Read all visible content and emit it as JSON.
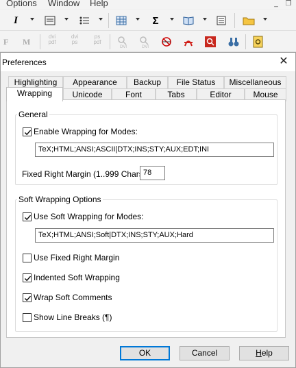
{
  "app": {
    "menu": [
      "Options",
      "Window",
      "Help"
    ],
    "mdi_minimize": "_",
    "mdi_restore": "❐",
    "toolbar2_text": {
      "f": "F",
      "m": "M",
      "dvi_pdf_top": "dvi",
      "dvi_pdf_bottom": "pdf",
      "dvi_ps_top": "dvi",
      "dvi_ps_bottom": "ps",
      "ps_pdf_top": "ps",
      "ps_pdf_bottom": "pdf",
      "dvi_a": "DVI",
      "dvi_b": "DVI"
    },
    "toolbar1_text": {
      "italic": "I",
      "sigma": "Σ"
    }
  },
  "dialog": {
    "title": "Preferences",
    "close_glyph": "✕",
    "tabs_back": [
      "Highlighting",
      "Appearance",
      "Backup",
      "File Status",
      "Miscellaneous"
    ],
    "tabs_front": [
      "Wrapping",
      "Unicode",
      "Font",
      "Tabs",
      "Editor",
      "Mouse"
    ],
    "general": {
      "legend": "General",
      "enable_wrapping_label": "Enable Wrapping for Modes:",
      "enable_wrapping_checked": true,
      "wrapping_modes": "TeX;HTML;ANSI;ASCII|DTX;INS;STY;AUX;EDT;INI",
      "fixed_margin_label": "Fixed Right Margin (1..999 Chars):",
      "fixed_margin_value": "78"
    },
    "soft": {
      "legend": "Soft Wrapping Options",
      "use_soft_label": "Use Soft Wrapping for Modes:",
      "use_soft_checked": true,
      "soft_modes": "TeX;HTML;ANSI;Soft|DTX;INS;STY;AUX;Hard",
      "fixed_margin_label": "Use Fixed Right Margin",
      "fixed_margin_checked": false,
      "indented_label": "Indented Soft Wrapping",
      "indented_checked": true,
      "wrap_comments_label": "Wrap Soft Comments",
      "wrap_comments_checked": true,
      "line_breaks_label": "Show Line Breaks (¶)",
      "line_breaks_checked": false
    },
    "buttons": {
      "ok": "OK",
      "cancel": "Cancel",
      "help_first": "H",
      "help_rest": "elp"
    }
  }
}
